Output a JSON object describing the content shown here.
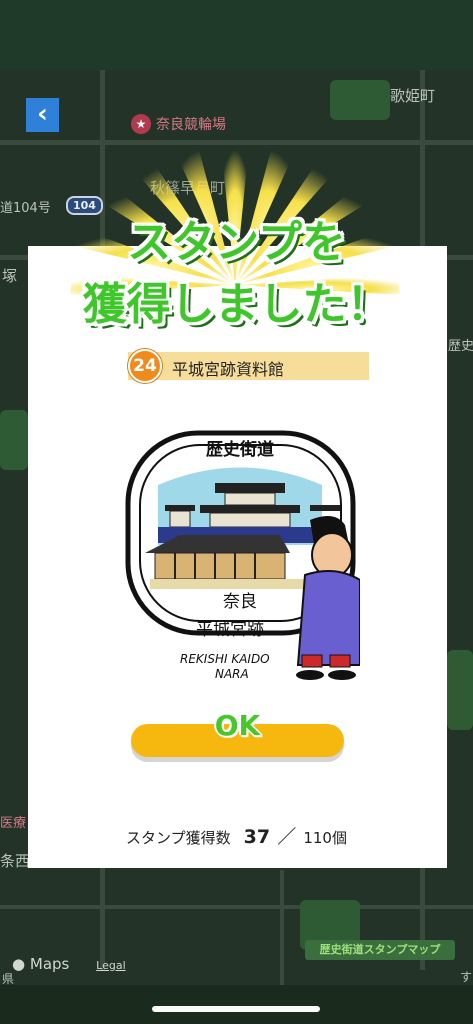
{
  "map": {
    "labels": {
      "utahime": "歌姫町",
      "akishino": "秋篠早月町",
      "route104": "道104号",
      "tsuka": "塚",
      "reki": "歴史",
      "iryo": "医療",
      "jodo": "条西",
      "kenmin": "県",
      "sm": "す"
    },
    "poi": "奈良競輪場",
    "route_shield": "104",
    "banner": "歴史街道スタンプマップ"
  },
  "attribution": {
    "maps": "Maps",
    "legal": "Legal"
  },
  "dialog": {
    "title_line1": "スタンプを",
    "title_line2": "獲得しました！",
    "stamp_number": "24",
    "stamp_name": "平城宮跡資料館",
    "stamp_image": {
      "heading": "歴史街道",
      "place1": "奈良",
      "place2": "平城宮跡",
      "roman1": "REKISHI KAIDO",
      "roman2": "NARA"
    },
    "ok_label": "OK",
    "count_label": "スタンプ獲得数",
    "count_value": "37",
    "count_separator": "／",
    "count_total": "110個"
  },
  "icons": {
    "back": "chevron-left-icon",
    "apple": "apple-icon"
  },
  "colors": {
    "title_green": "#3ec62a",
    "ok_button": "#f6b80f",
    "badge_orange": "#ef8b1c",
    "bar": "#f7dd9a"
  }
}
